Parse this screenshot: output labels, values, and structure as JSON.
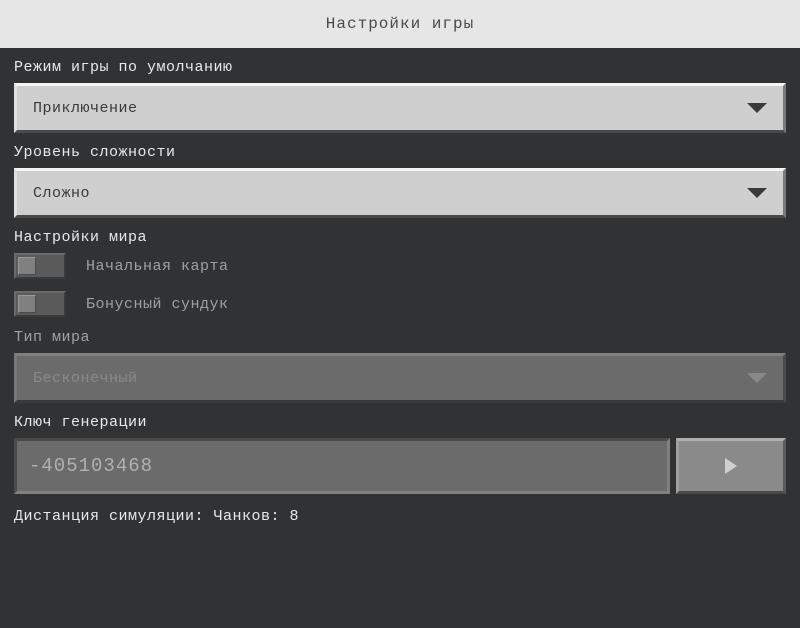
{
  "header": {
    "title": "Настройки игры"
  },
  "gameMode": {
    "label": "Режим игры по умолчанию",
    "value": "Приключение"
  },
  "difficulty": {
    "label": "Уровень сложности",
    "value": "Сложно"
  },
  "worldSettings": {
    "label": "Настройки мира",
    "startingMap": {
      "label": "Начальная карта",
      "enabled": false
    },
    "bonusChest": {
      "label": "Бонусный сундук",
      "enabled": false
    }
  },
  "worldType": {
    "label": "Тип мира",
    "value": "Бесконечный"
  },
  "seed": {
    "label": "Ключ генерации",
    "value": "-405103468"
  },
  "simulationDistance": {
    "label": "Дистанция симуляции: Чанков: 8"
  }
}
